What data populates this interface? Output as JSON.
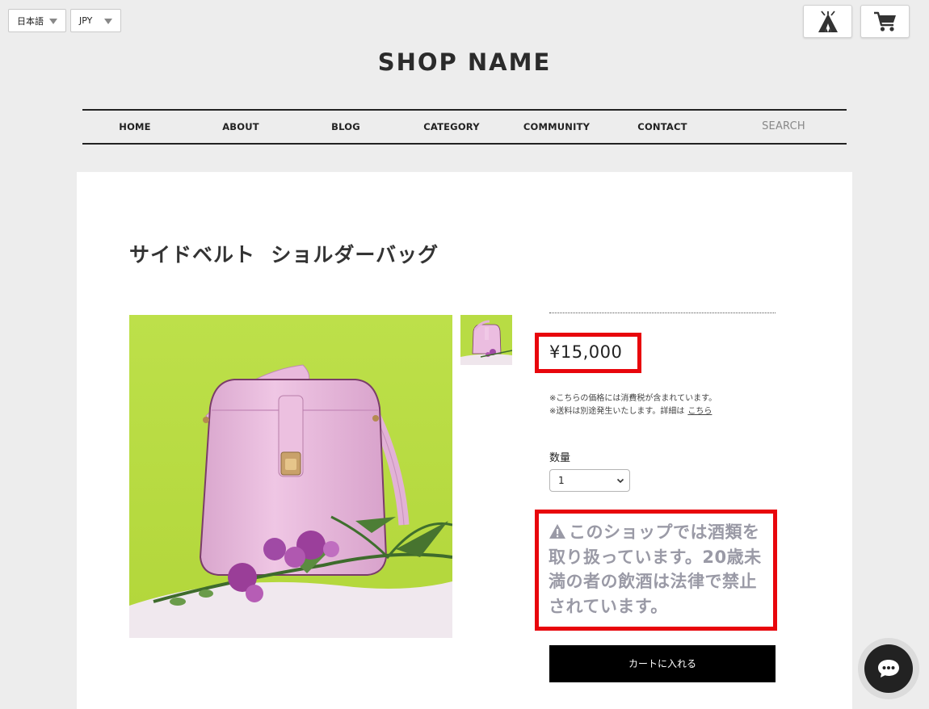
{
  "top_bar": {
    "language": "日本語",
    "currency": "JPY",
    "icons": [
      "tent-icon",
      "cart-icon"
    ]
  },
  "shop_name": "SHOP NAME",
  "nav": {
    "items": [
      "HOME",
      "ABOUT",
      "BLOG",
      "CATEGORY",
      "COMMUNITY",
      "CONTACT"
    ],
    "search_placeholder": "SEARCH"
  },
  "product": {
    "title": "サイドベルト  ショルダーバッグ",
    "price": "¥15,000",
    "tax_note": "※こちらの価格には消費税が含まれています。",
    "shipping_note": "※送料は別途発生いたします。詳細は",
    "shipping_link": "こちら",
    "quantity_label": "数量",
    "quantity_value": "1",
    "warning": "このショップでは酒類を取り扱っています。20歳未満の者の飲酒は法律で禁止されています。",
    "add_to_cart": "カートに入れる"
  },
  "colors": {
    "highlight": "#e8060c",
    "background": "#ededed",
    "button": "#000000",
    "warning_text": "#9a9aa6"
  }
}
